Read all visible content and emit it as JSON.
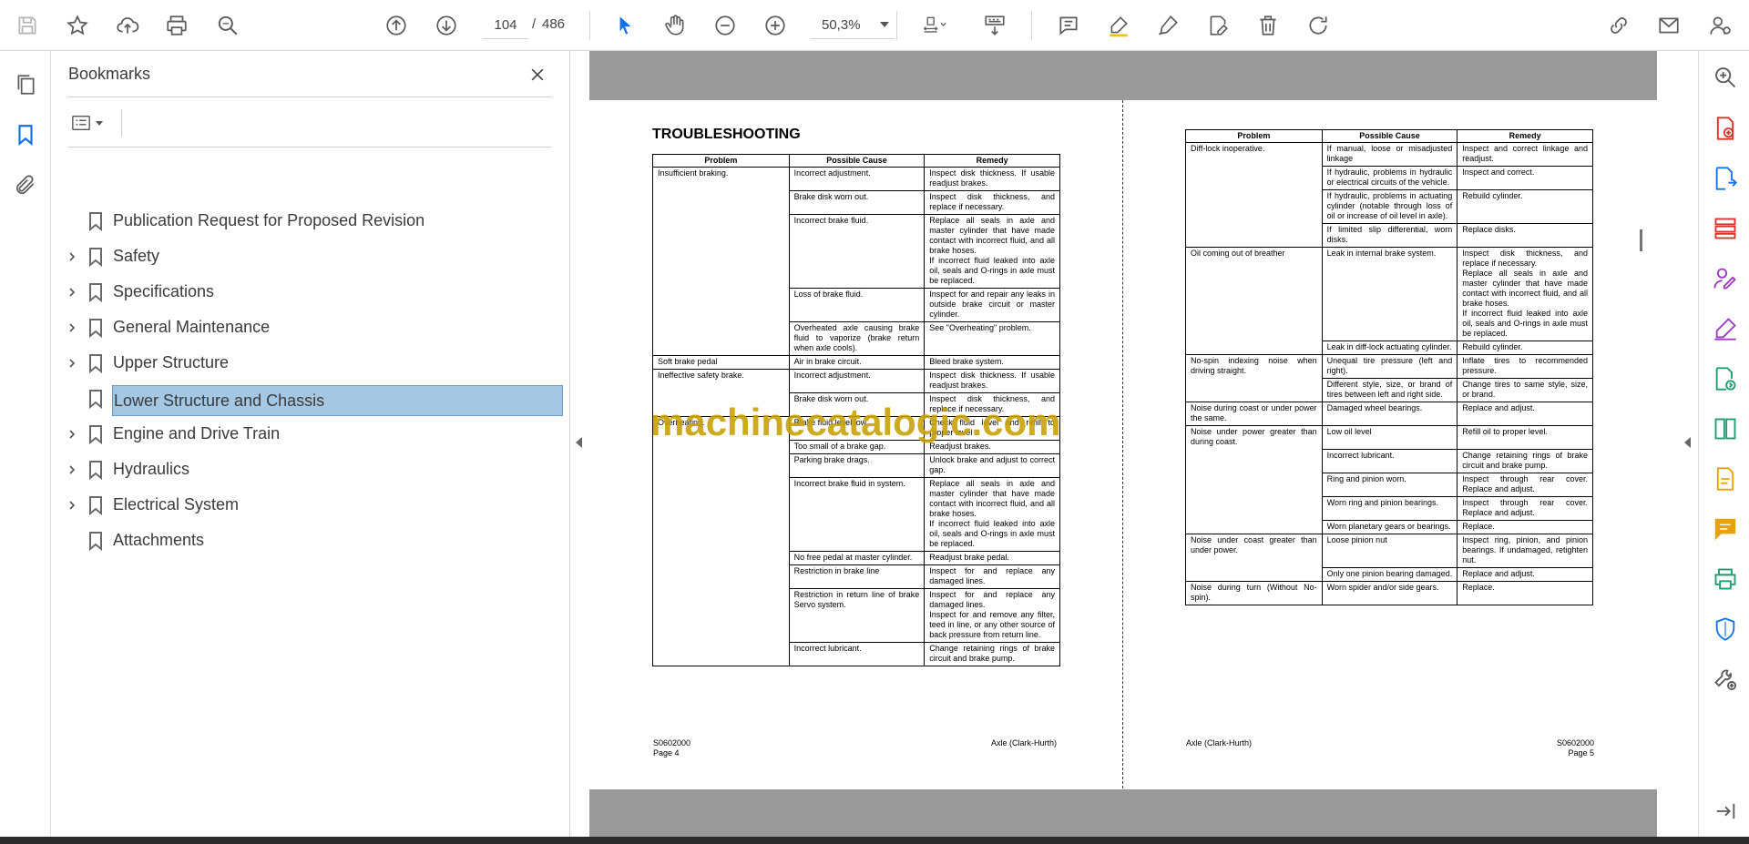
{
  "toolbar": {
    "page_current": "104",
    "page_sep": "/",
    "page_total": "486",
    "zoom": "50,3%"
  },
  "bookmarks": {
    "title": "Bookmarks",
    "items": [
      {
        "label": "Publication Request for Proposed Revision",
        "expandable": false,
        "selected": false
      },
      {
        "label": "Safety",
        "expandable": true,
        "selected": false
      },
      {
        "label": "Specifications",
        "expandable": true,
        "selected": false
      },
      {
        "label": "General Maintenance",
        "expandable": true,
        "selected": false
      },
      {
        "label": "Upper Structure",
        "expandable": true,
        "selected": false
      },
      {
        "label": "Lower Structure and Chassis",
        "expandable": false,
        "selected": true
      },
      {
        "label": "Engine and Drive Train",
        "expandable": true,
        "selected": false
      },
      {
        "label": "Hydraulics",
        "expandable": true,
        "selected": false
      },
      {
        "label": "Electrical System",
        "expandable": true,
        "selected": false
      },
      {
        "label": "Attachments",
        "expandable": false,
        "selected": false
      }
    ]
  },
  "doc": {
    "title": "TROUBLESHOOTING",
    "headers": [
      "Problem",
      "Possible Cause",
      "Remedy"
    ],
    "left_rows": [
      [
        "Insufficient braking.",
        "Incorrect adjustment.",
        "Inspect disk thickness. If usable readjust brakes."
      ],
      [
        "",
        "Brake disk worn out.",
        "Inspect disk thickness, and replace if necessary."
      ],
      [
        "",
        "Incorrect brake fluid.",
        "Replace all seals in axle and master cylinder that have made contact with incorrect fluid, and all brake hoses.\nIf incorrect fluid leaked into axle oil, seals and O-rings in axle must be replaced."
      ],
      [
        "",
        "Loss of brake fluid.",
        "Inspect for and repair any leaks in outside brake circuit or master cylinder."
      ],
      [
        "",
        "Overheated axle causing brake fluid to vaporize (brake return when axle cools).",
        "See \"Overheating\" problem."
      ],
      [
        "Soft brake pedal",
        "Air in brake circuit.",
        "Bleed brake system."
      ],
      [
        "Ineffective safety brake.",
        "Incorrect adjustment.",
        "Inspect disk thickness. If usable readjust brakes."
      ],
      [
        "",
        "Brake disk worn out.",
        "Inspect disk thickness, and replace if necessary."
      ],
      [
        "Overheating.",
        "Brake fluid level low.",
        "Check fluid level and refill to proper level"
      ],
      [
        "",
        "Too small of a brake gap.",
        "Readjust brakes."
      ],
      [
        "",
        "Parking brake drags.",
        "Unlock brake and adjust to correct gap."
      ],
      [
        "",
        "Incorrect brake fluid in system.",
        "Replace all seals in axle and master cylinder that have made contact with incorrect fluid, and all brake hoses.\nIf incorrect fluid leaked into axle oil, seals and O-rings in axle must be replaced."
      ],
      [
        "",
        "No free pedal at master cylinder.",
        "Readjust brake pedal."
      ],
      [
        "",
        "Restriction in brake line",
        "Inspect for and replace any damaged lines."
      ],
      [
        "",
        "Restriction in return line of brake Servo system.",
        "Inspect for and replace any damaged lines.\nInspect for and remove any filter, teed in line, or any other source of back pressure from return line."
      ],
      [
        "",
        "Incorrect lubricant.",
        "Change retaining rings of brake circuit and brake pump."
      ]
    ],
    "right_rows": [
      [
        "Diff-lock inoperative.",
        "If manual, loose or misadjusted linkage",
        "Inspect and correct linkage and readjust."
      ],
      [
        "",
        "If hydraulic, problems in hydraulic or electrical circuits of the vehicle.",
        "Inspect and correct."
      ],
      [
        "",
        "If hydraulic, problems in actuating cylinder (notable through loss of oil or increase of oil level in axle).",
        "Rebuild cylinder."
      ],
      [
        "",
        "If limited slip differential, worn disks.",
        "Replace disks."
      ],
      [
        "Oil coming out of breather",
        "Leak in internal brake system.",
        "Inspect disk thickness, and replace if necessary.\nReplace all seals in axle and master cylinder that have made contact with incorrect fluid, and all brake hoses.\nIf incorrect fluid leaked into axle oil, seals and O-rings in axle must be replaced."
      ],
      [
        "",
        "Leak in diff-lock actuating cylinder.",
        "Rebuild cylinder."
      ],
      [
        "No-spin indexing noise when driving straight.",
        "Unequal tire pressure (left and right).",
        "Inflate tires to recommended pressure."
      ],
      [
        "",
        "Different style, size, or brand of tires between left and right side.",
        "Change tires to same style, size, or brand."
      ],
      [
        "Noise during coast or under power the same.",
        "Damaged wheel bearings.",
        "Replace and adjust."
      ],
      [
        "Noise under power greater than during coast.",
        "Low oil level",
        "Refill oil to proper level."
      ],
      [
        "",
        "Incorrect lubricant.",
        "Change retaining rings of brake circuit and brake pump."
      ],
      [
        "",
        "Ring and pinion worn.",
        "Inspect through rear cover. Replace and adjust."
      ],
      [
        "",
        "Worn ring and pinion bearings.",
        "Inspect through rear cover. Replace and adjust."
      ],
      [
        "",
        "Worn planetary gears or bearings.",
        "Replace."
      ],
      [
        "Noise under coast greater than under power.",
        "Loose pinion nut",
        "Inspect ring, pinion, and pinion bearings. If undamaged, retighten nut."
      ],
      [
        "",
        "Only one pinion bearing damaged.",
        "Replace and adjust."
      ],
      [
        "Noise during turn (Without No-spin).",
        "Worn spider and/or side gears.",
        "Replace."
      ]
    ],
    "footer_left": {
      "code": "S0602000",
      "page": "Page 4",
      "section": "Axle (Clark-Hurth)"
    },
    "footer_right": {
      "code": "S0602000",
      "page": "Page 5",
      "section": "Axle (Clark-Hurth)"
    },
    "watermark": "machinecatalogic.com"
  },
  "colors": {
    "selected_bookmark_bg": "#a4c7e3",
    "viewer_band": "#9a9a9a",
    "right_rail_accent": "#d9342b",
    "watermark": "#c9a106"
  }
}
